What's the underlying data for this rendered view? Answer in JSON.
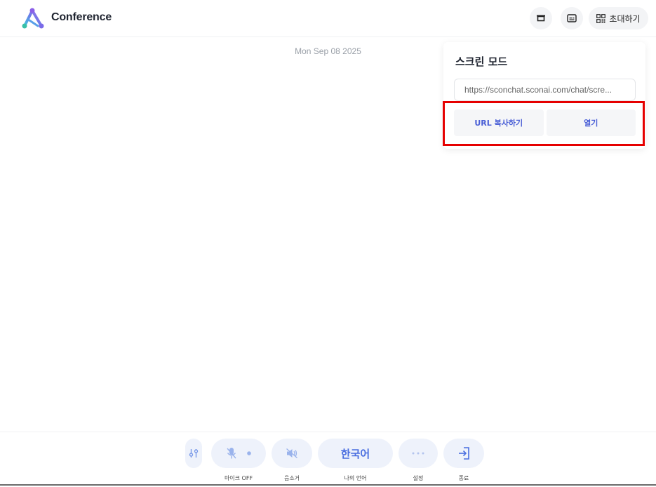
{
  "header": {
    "app_title": "Conference",
    "invite_label": "초대하기"
  },
  "date": "Mon Sep 08 2025",
  "popup": {
    "title": "스크린 모드",
    "url_value": "https://sconchat.sconai.com/chat/scre...",
    "copy_label": "URL 복사하기",
    "open_label": "열기"
  },
  "toolbar": {
    "mic_label": "마이크 OFF",
    "mute_label": "음소거",
    "language_value": "한국어",
    "language_label": "나의 언어",
    "settings_label": "설정",
    "exit_label": "종료"
  },
  "colors": {
    "accent": "#4a6ee0",
    "highlight": "#e60000",
    "button_bg": "#eef2fb"
  }
}
